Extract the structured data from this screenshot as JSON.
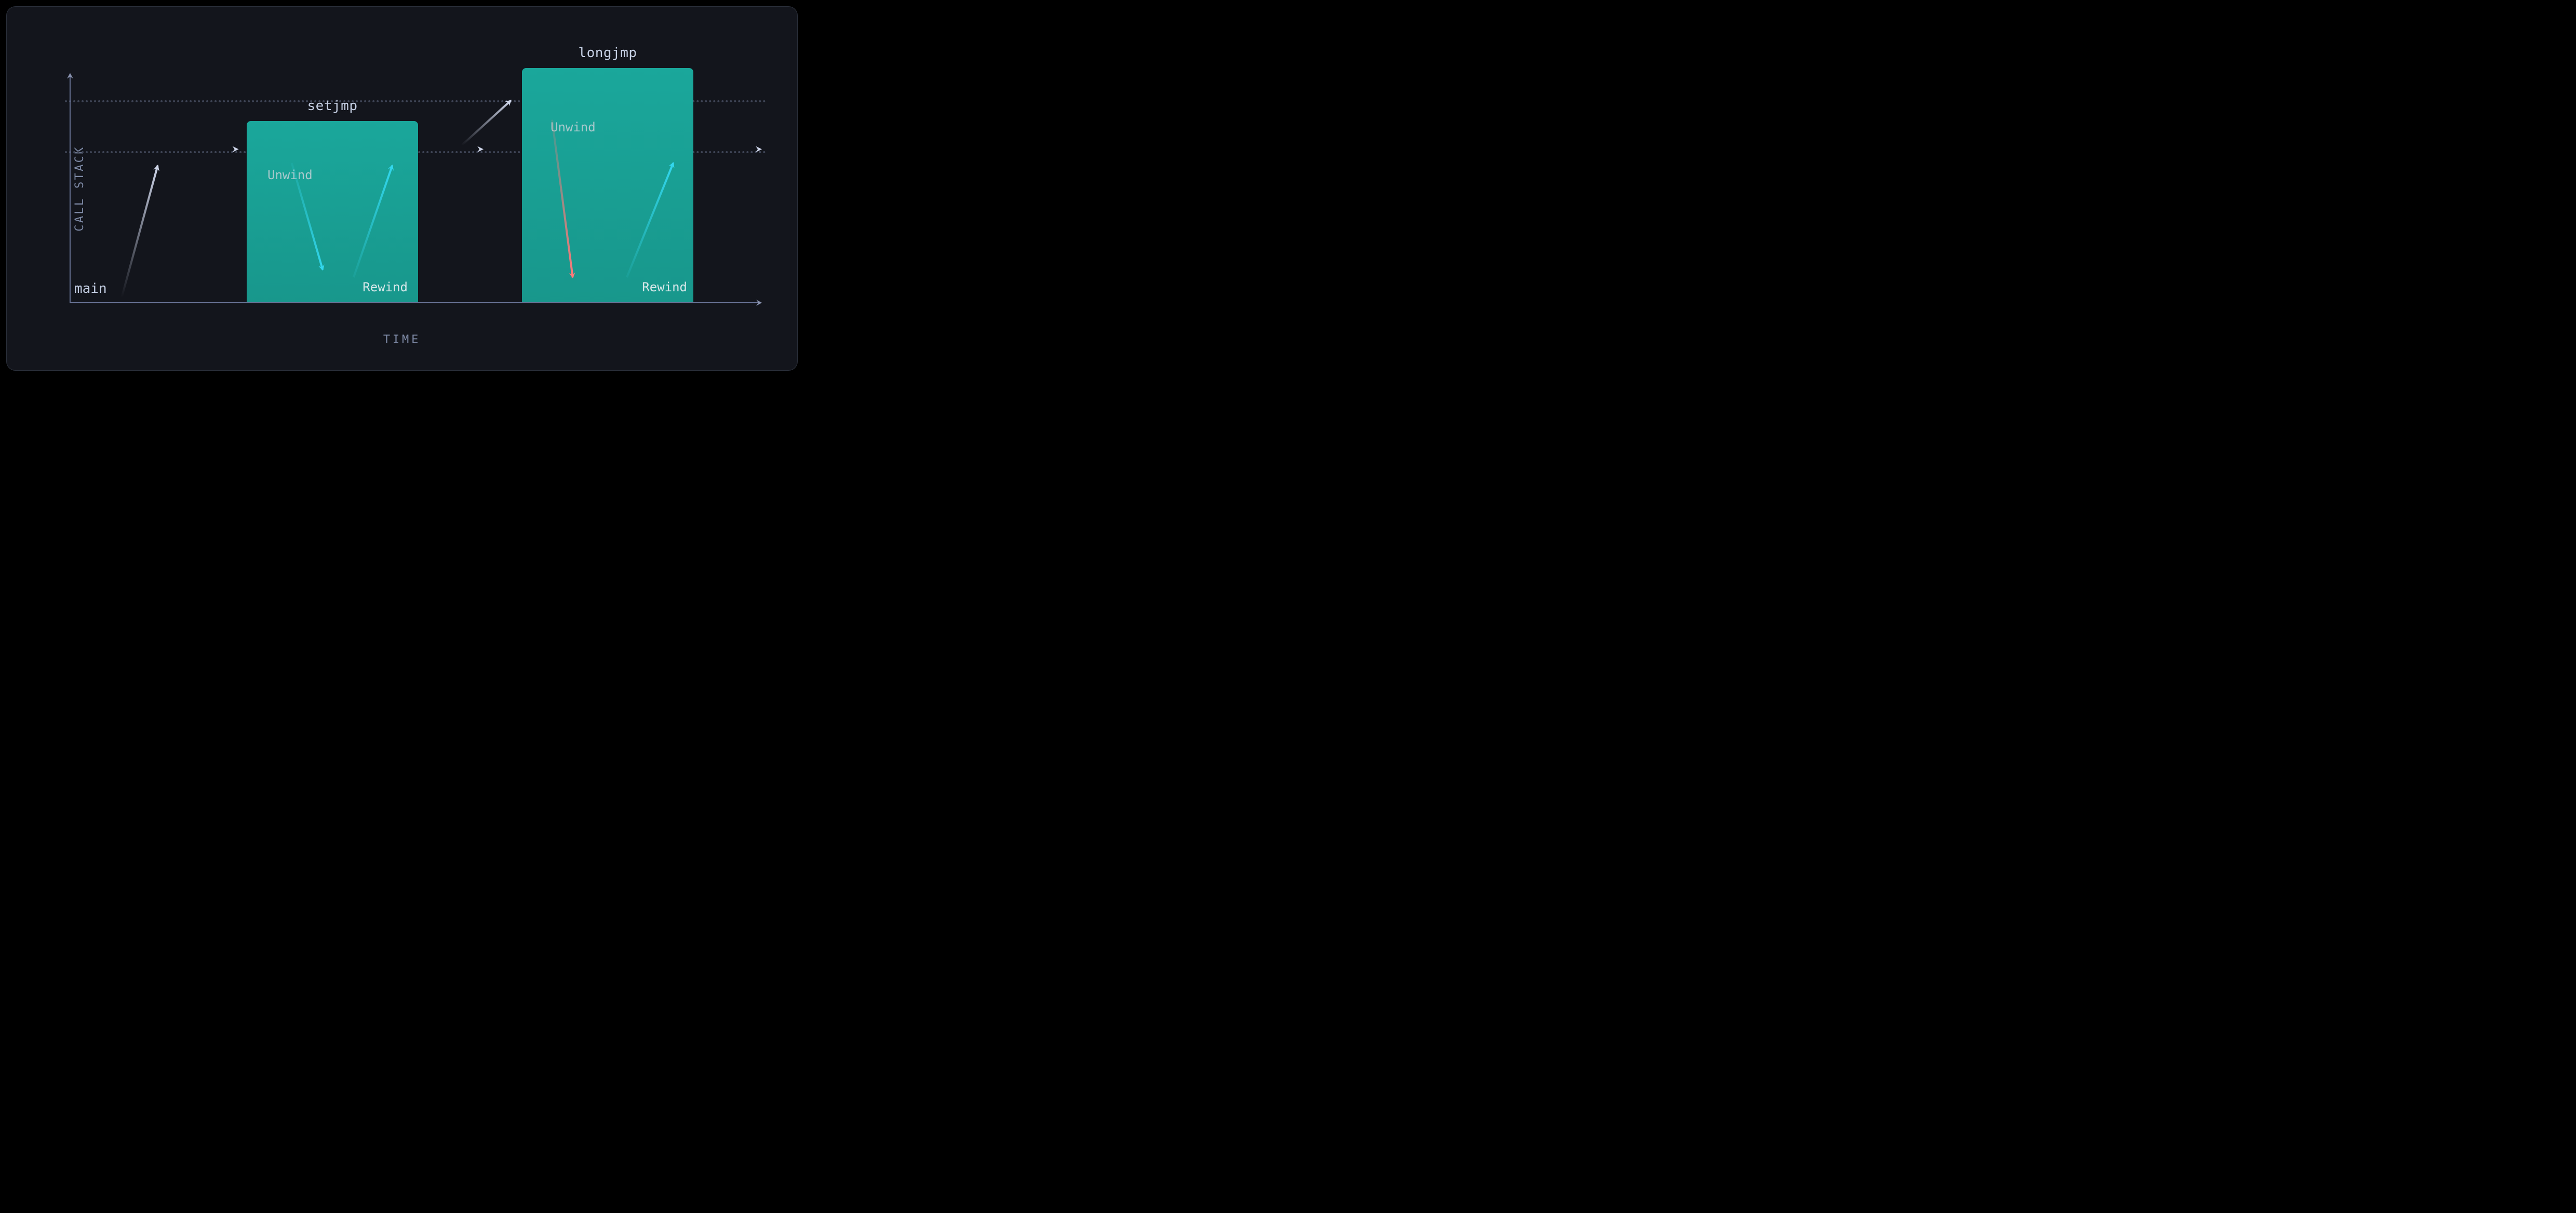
{
  "axes": {
    "y": "CALL STACK",
    "x": "TIME"
  },
  "origin_label": "main",
  "blocks": {
    "setjmp": {
      "title": "setjmp",
      "unwind": "Unwind",
      "rewind": "Rewind"
    },
    "longjmp": {
      "title": "longjmp",
      "unwind": "Unwind",
      "rewind": "Rewind"
    }
  },
  "colors": {
    "bg": "#13151c",
    "teal": "#1aa79b",
    "axis": "#697497",
    "text_muted": "#7e8aa6",
    "text": "#c3cde2",
    "cyan": "#33d7ee",
    "red": "#ff7a7a"
  },
  "chart_data": {
    "type": "diagram",
    "title": "",
    "xlabel": "TIME",
    "ylabel": "CALL STACK",
    "x": [
      0,
      1,
      2,
      3,
      4,
      5,
      6,
      7,
      8
    ],
    "stack_depth": [
      0,
      1,
      2,
      2,
      0,
      2,
      2,
      3,
      2
    ],
    "annotations": [
      {
        "at": 0,
        "text": "main"
      },
      {
        "region": [
          3,
          5
        ],
        "text": "setjmp",
        "sub": [
          "Unwind",
          "Rewind"
        ]
      },
      {
        "region": [
          6,
          8
        ],
        "text": "longjmp",
        "sub": [
          "Unwind",
          "Rewind"
        ]
      }
    ],
    "guides_y": [
      2,
      3
    ]
  }
}
